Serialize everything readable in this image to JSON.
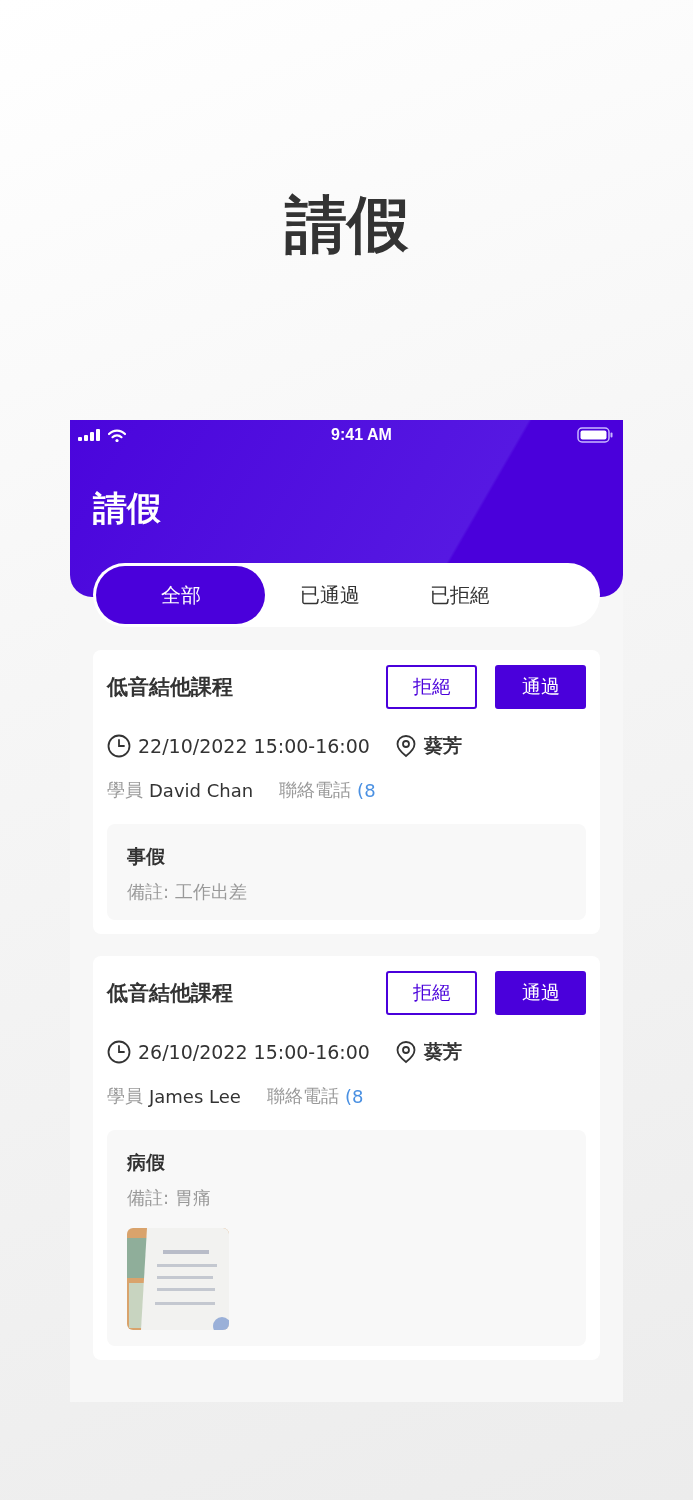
{
  "title": "請假",
  "phone": {
    "status_bar": {
      "time": "9:41 AM"
    },
    "header_title": "請假",
    "tabs": [
      {
        "label": "全部",
        "selected": true
      },
      {
        "label": "已通過",
        "selected": false
      },
      {
        "label": "已拒絕",
        "selected": false
      }
    ],
    "requests": [
      {
        "course": "低音結他課程",
        "reject_label": "拒絕",
        "approve_label": "通過",
        "datetime": "22/10/2022 15:00-16:00",
        "location": "葵芳",
        "student_label": "學員",
        "student_name": "David Chan",
        "contact_label": "聯絡電話",
        "contact_value": "(8",
        "leave_type": "事假",
        "remark": "備註: 工作出差"
      },
      {
        "course": "低音結他課程",
        "reject_label": "拒絕",
        "approve_label": "通過",
        "datetime": "26/10/2022 15:00-16:00",
        "location": "葵芳",
        "student_label": "學員",
        "student_name": "James Lee",
        "contact_label": "聯絡電話",
        "contact_value": "(8",
        "leave_type": "病假",
        "remark": "備註: 胃痛"
      }
    ]
  }
}
